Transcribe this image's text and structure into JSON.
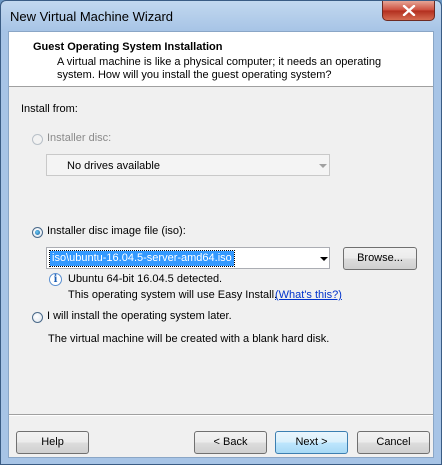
{
  "window": {
    "title": "New Virtual Machine Wizard"
  },
  "header": {
    "title": "Guest Operating System Installation",
    "description": "A virtual machine is like a physical computer; it needs an operating system. How will you install the guest operating system?"
  },
  "install_from": {
    "label": "Install from:",
    "installer_disc": {
      "label": "Installer disc:",
      "selected": false,
      "enabled": false,
      "drive_value": "No drives available"
    },
    "iso_option": {
      "label": "Installer disc image file (iso):",
      "selected": true,
      "path_value": "iso\\ubuntu-16.04.5-server-amd64.iso",
      "browse_label": "Browse...",
      "detected_text": "Ubuntu 64-bit 16.04.5 detected.",
      "easy_install_text": "This operating system will use Easy Install.",
      "whats_this_link": "(What's this?)"
    },
    "later_option": {
      "label": "I will install the operating system later.",
      "selected": false,
      "note": "The virtual machine will be created with a blank hard disk."
    }
  },
  "buttons": {
    "help": "Help",
    "back": "< Back",
    "next": "Next >",
    "cancel": "Cancel"
  },
  "icons": {
    "close": "close-icon",
    "info": "info-icon",
    "dropdown": "chevron-down-icon"
  }
}
